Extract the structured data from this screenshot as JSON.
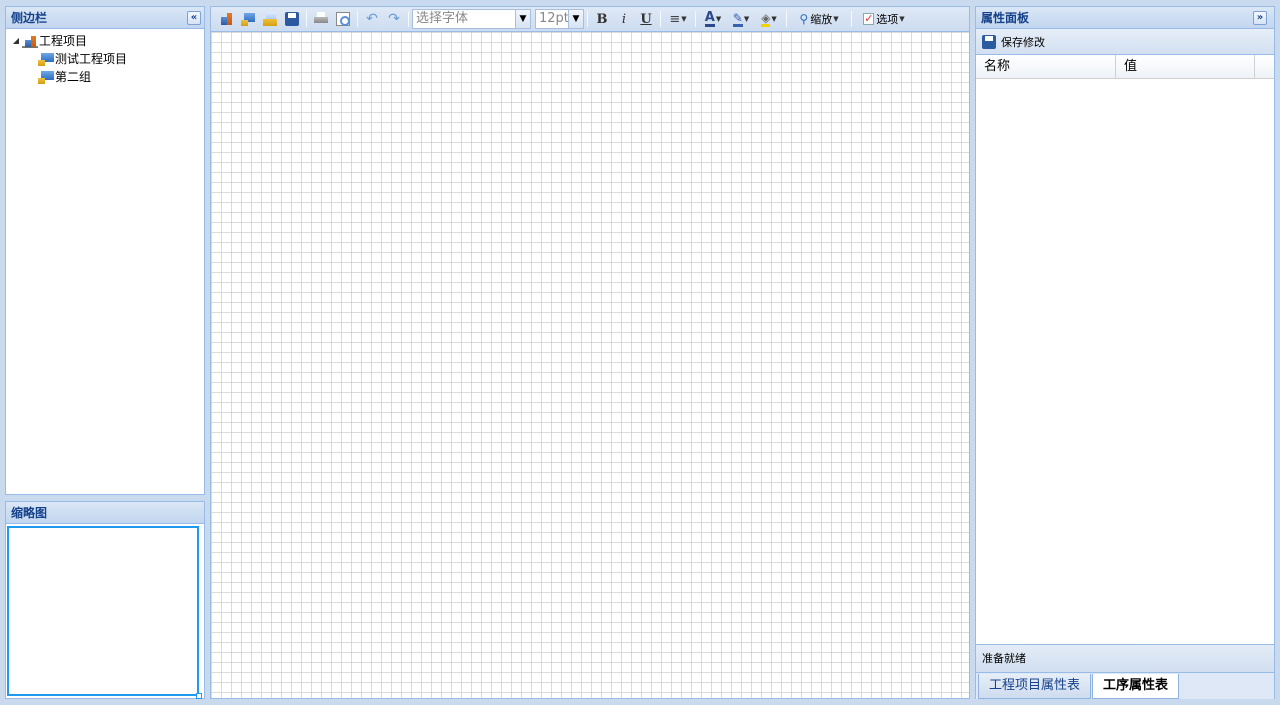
{
  "sidebar": {
    "title": "侧边栏",
    "collapse_icon": "«",
    "tree": {
      "root": "工程项目",
      "children": [
        "测试工程项目",
        "第二组"
      ]
    }
  },
  "thumbnail": {
    "title": "缩略图"
  },
  "editor": {
    "toolbar": {
      "font_placeholder": "选择字体",
      "font_size": "12pt",
      "bold": "B",
      "italic": "i",
      "underline": "U",
      "zoom_label": "缩放",
      "options_label": "选项"
    }
  },
  "properties": {
    "title": "属性面板",
    "expand_icon": "»",
    "save_label": "保存修改",
    "columns": [
      "名称",
      "值"
    ],
    "status": "准备就绪",
    "tabs": [
      {
        "label": "工程项目属性表",
        "active": false
      },
      {
        "label": "工序属性表",
        "active": true
      }
    ]
  },
  "colors": {
    "header_text": "#15428b",
    "border": "#99bbe8",
    "selection": "#1e9bf0"
  }
}
